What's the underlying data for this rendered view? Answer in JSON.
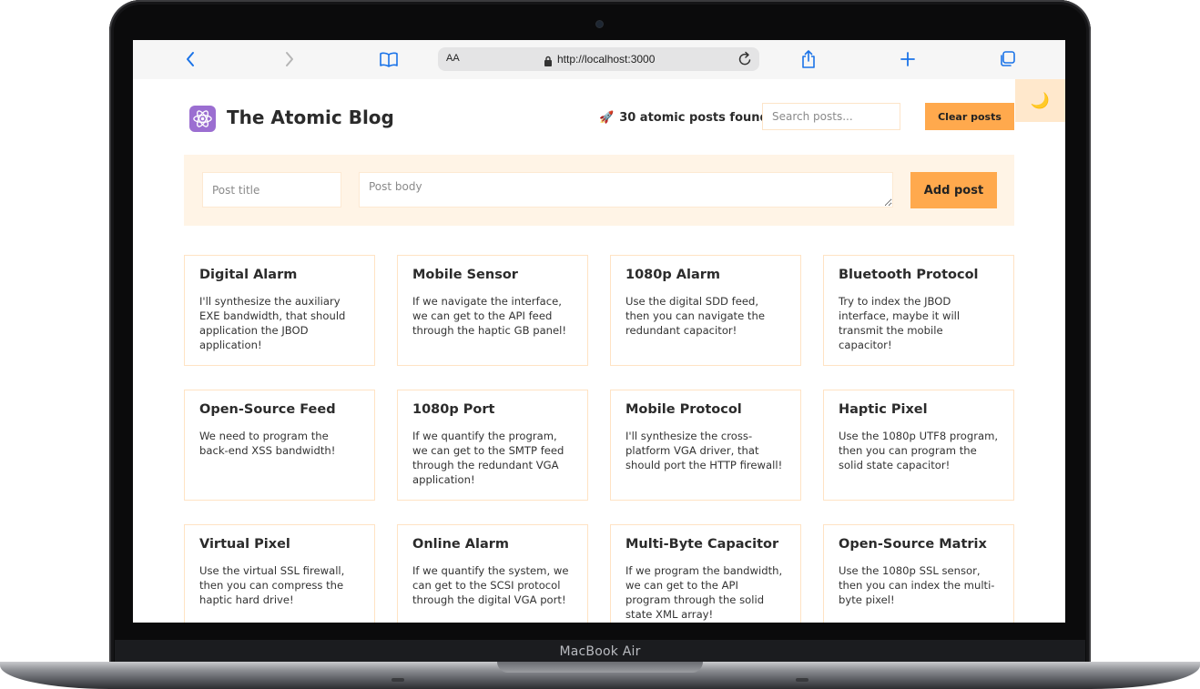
{
  "device": {
    "label": "MacBook Air"
  },
  "browser": {
    "text_size_label": "AA",
    "url": "http://localhost:3000"
  },
  "header": {
    "title": "The Atomic Blog",
    "posts_found_icon": "rocket-icon",
    "posts_found": "30 atomic posts found",
    "search_placeholder": "Search posts...",
    "clear_label": "Clear posts",
    "theme_toggle_icon": "moon-icon"
  },
  "form": {
    "title_placeholder": "Post title",
    "body_placeholder": "Post body",
    "add_label": "Add post"
  },
  "posts": [
    {
      "title": "Digital Alarm",
      "body": "I'll synthesize the auxiliary EXE bandwidth, that should application the JBOD application!"
    },
    {
      "title": "Mobile Sensor",
      "body": "If we navigate the interface, we can get to the API feed through the haptic GB panel!"
    },
    {
      "title": "1080p Alarm",
      "body": "Use the digital SDD feed, then you can navigate the redundant capacitor!"
    },
    {
      "title": "Bluetooth Protocol",
      "body": "Try to index the JBOD interface, maybe it will transmit the mobile capacitor!"
    },
    {
      "title": "Open-Source Feed",
      "body": "We need to program the back-end XSS bandwidth!"
    },
    {
      "title": "1080p Port",
      "body": "If we quantify the program, we can get to the SMTP feed through the redundant VGA application!"
    },
    {
      "title": "Mobile Protocol",
      "body": "I'll synthesize the cross-platform VGA driver, that should port the HTTP firewall!"
    },
    {
      "title": "Haptic Pixel",
      "body": "Use the 1080p UTF8 program, then you can program the solid state capacitor!"
    },
    {
      "title": "Virtual Pixel",
      "body": "Use the virtual SSL firewall, then you can compress the haptic hard drive!"
    },
    {
      "title": "Online Alarm",
      "body": "If we quantify the system, we can get to the SCSI protocol through the digital VGA port!"
    },
    {
      "title": "Multi-Byte Capacitor",
      "body": "If we program the bandwidth, we can get to the API program through the solid state XML array!"
    },
    {
      "title": "Open-Source Matrix",
      "body": "Use the 1080p SSL sensor, then you can index the multi-byte pixel!"
    }
  ],
  "colors": {
    "accent": "#ffa94d",
    "panel": "#fff4e6",
    "card_border": "#ffe3c4",
    "logo_bg": "#9b6ed1",
    "browser_blue": "#1a73e8"
  }
}
